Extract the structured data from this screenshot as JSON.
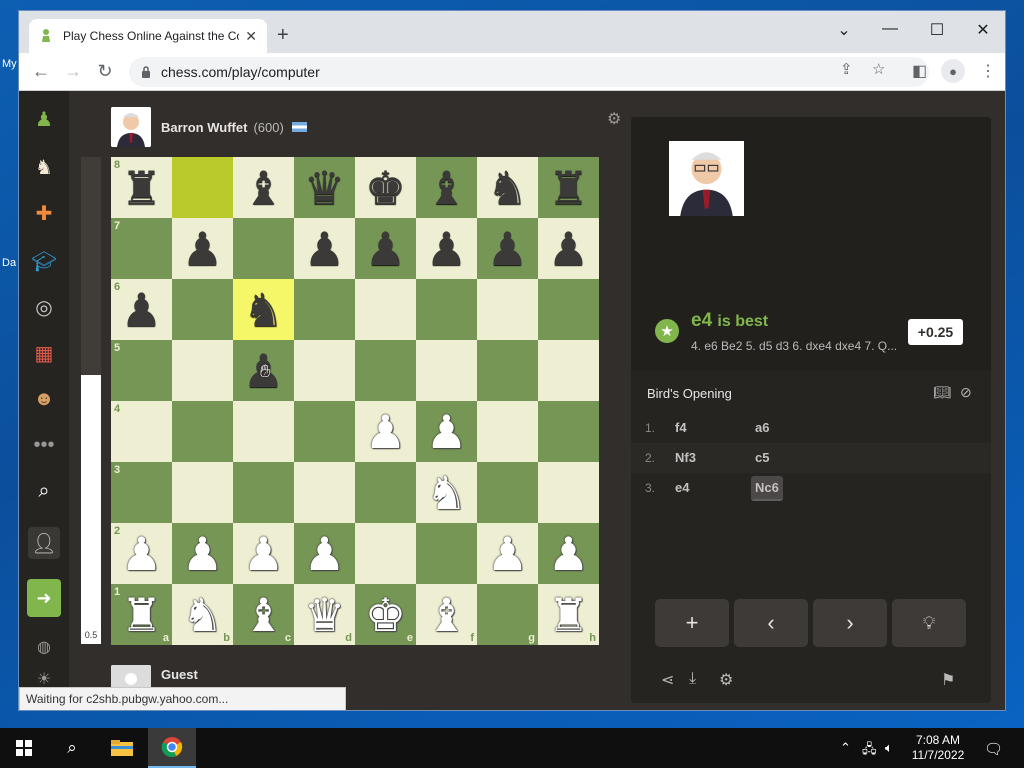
{
  "desktop": {
    "label_my": "My",
    "label_da": "Da"
  },
  "browser": {
    "tab_title": "Play Chess Online Against the Co",
    "url": "chess.com/play/computer",
    "status_text": "Waiting for c2shb.pubgw.yahoo.com..."
  },
  "game": {
    "opponent": {
      "name": "Barron Wuffet",
      "rating": "(600)"
    },
    "player": {
      "name": "Guest"
    },
    "eval_bar_value": "0.5",
    "board": [
      [
        "br",
        "",
        "bb",
        "bq",
        "bk",
        "bb",
        "bn",
        "br"
      ],
      [
        "",
        "bp",
        "",
        "bp",
        "bp",
        "bp",
        "bp",
        "bp"
      ],
      [
        "bp",
        "",
        "bn",
        "",
        "",
        "",
        "",
        ""
      ],
      [
        "",
        "",
        "bp",
        "",
        "",
        "",
        "",
        ""
      ],
      [
        "",
        "",
        "",
        "",
        "wp",
        "wp",
        "",
        ""
      ],
      [
        "",
        "",
        "",
        "",
        "",
        "wn",
        "",
        ""
      ],
      [
        "wp",
        "wp",
        "wp",
        "wp",
        "",
        "",
        "wp",
        "wp"
      ],
      [
        "wr",
        "wn",
        "wb",
        "wq",
        "wk",
        "wb",
        "",
        "wr"
      ]
    ],
    "highlight_squares": [
      "b8",
      "c6"
    ],
    "ranks": [
      "8",
      "7",
      "6",
      "5",
      "4",
      "3",
      "2",
      "1"
    ],
    "files": [
      "a",
      "b",
      "c",
      "d",
      "e",
      "f",
      "g",
      "h"
    ]
  },
  "analysis": {
    "best_move": "e4",
    "best_label": "is best",
    "best_line": "4. e6 Be2 5. d5 d3 6. dxe4 dxe4 7. Q...",
    "eval": "+0.25",
    "opening": "Bird's Opening",
    "moves": [
      {
        "num": "1.",
        "white": "f4",
        "black": "a6"
      },
      {
        "num": "2.",
        "white": "Nf3",
        "black": "c5"
      },
      {
        "num": "3.",
        "white": "e4",
        "black": "Nc6"
      }
    ]
  },
  "taskbar": {
    "time": "7:08 AM",
    "date": "11/7/2022"
  },
  "colors": {
    "board_light": "#eeeed2",
    "board_dark": "#769656",
    "accent": "#81b64c"
  }
}
